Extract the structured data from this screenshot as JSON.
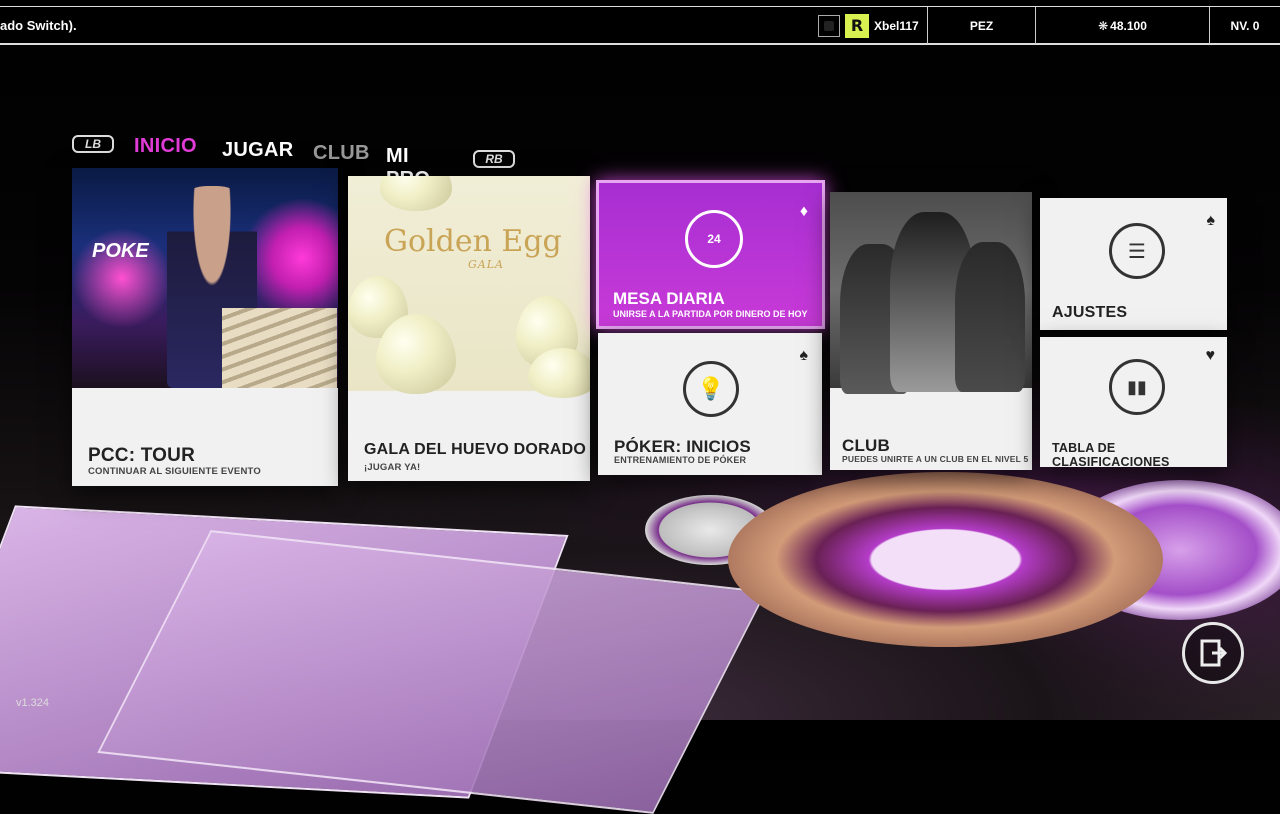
{
  "topbar": {
    "message": "ado Switch).",
    "username": "Xbel117",
    "currency_label": "PEZ",
    "chips": "48.100",
    "level": "NV. 0"
  },
  "nav": {
    "left_bumper": "LB",
    "right_bumper": "RB",
    "tabs": [
      {
        "label": "INICIO",
        "active": true
      },
      {
        "label": "JUGAR",
        "active": false
      },
      {
        "label": "CLUB",
        "active": false
      },
      {
        "label": "MI PRO",
        "active": false
      }
    ]
  },
  "cards": {
    "tour": {
      "title": "PCC: TOUR",
      "subtitle": "CONTINUAR AL SIGUIENTE EVENTO",
      "art_text": "POKE"
    },
    "gala": {
      "title": "GALA DEL HUEVO DORADO",
      "subtitle": "¡JUGAR YA!",
      "art_title": "Golden Egg",
      "art_sub": "GALA"
    },
    "mesa": {
      "title": "MESA DIARIA",
      "subtitle": "UNIRSE A LA PARTIDA POR DINERO DE HOY",
      "icon": "24h-clock-icon",
      "icon_text": "24",
      "suit": "diamond"
    },
    "inicios": {
      "title": "PÓKER: INICIOS",
      "subtitle": "ENTRENAMIENTO DE PÓKER",
      "icon": "lightbulb-icon",
      "suit": "spade"
    },
    "club": {
      "title": "CLUB",
      "subtitle": "PUEDES UNIRTE A UN CLUB EN EL NIVEL 5"
    },
    "ajustes": {
      "title": "AJUSTES",
      "icon": "sliders-icon",
      "suit": "spade"
    },
    "clasificaciones": {
      "title": "TABLA DE CLASIFICACIONES",
      "icon": "bar-chart-icon",
      "suit": "heart"
    }
  },
  "exit_icon": "exit-door-icon",
  "version": "v1.324",
  "colors": {
    "accent": "#e23cd8",
    "mesa": "#b533d6"
  }
}
